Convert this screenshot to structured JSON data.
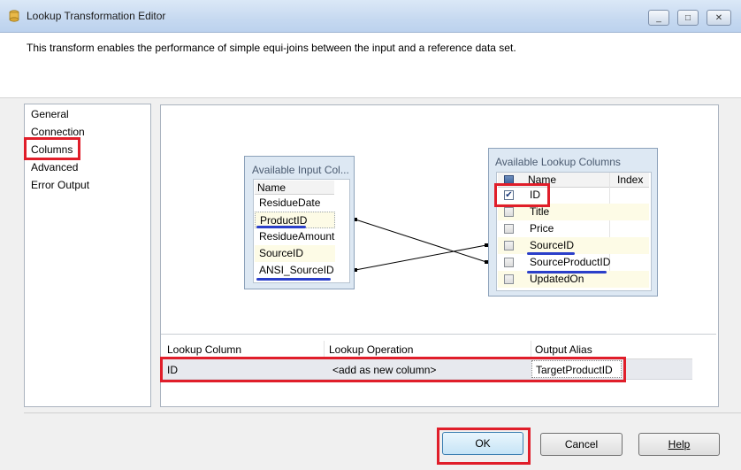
{
  "window": {
    "title": "Lookup Transformation Editor",
    "controls": {
      "minimize": "_",
      "maximize": "□",
      "close": "✕"
    }
  },
  "description": "This transform enables the performance of simple equi-joins between the input and a reference data set.",
  "nav": {
    "items": [
      "General",
      "Connection",
      "Columns",
      "Advanced",
      "Error Output"
    ],
    "selected": "Columns"
  },
  "input_columns": {
    "title": "Available Input Col...",
    "header": "Name",
    "rows": [
      "ResidueDate",
      "ProductID",
      "ResidueAmount",
      "SourceID",
      "ANSI_SourceID"
    ]
  },
  "lookup_columns": {
    "title": "Available Lookup Columns",
    "headers": {
      "name": "Name",
      "index": "Index"
    },
    "rows": [
      {
        "name": "ID",
        "checked": true
      },
      {
        "name": "Title",
        "checked": false
      },
      {
        "name": "Price",
        "checked": false
      },
      {
        "name": "SourceID",
        "checked": false
      },
      {
        "name": "SourceProductID",
        "checked": false
      },
      {
        "name": "UpdatedOn",
        "checked": false
      }
    ]
  },
  "mappings": [
    {
      "from": "ProductID",
      "to": "SourceProductID"
    },
    {
      "from": "ANSI_SourceID",
      "to": "SourceID"
    }
  ],
  "grid": {
    "headers": {
      "lookup_column": "Lookup Column",
      "lookup_operation": "Lookup Operation",
      "output_alias": "Output Alias"
    },
    "rows": [
      {
        "lookup_column": "ID",
        "lookup_operation": "<add as new column>",
        "output_alias": "TargetProductID"
      }
    ]
  },
  "buttons": {
    "ok": "OK",
    "cancel": "Cancel",
    "help": "Help"
  },
  "colors": {
    "highlight_red": "#e01e2a",
    "underline_blue": "#2b3fc9",
    "titlebar": "#c6d9f0"
  }
}
